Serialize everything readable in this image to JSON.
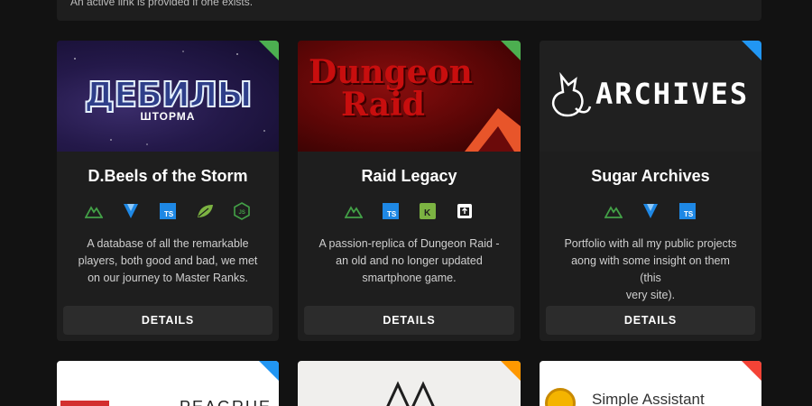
{
  "banner": {
    "text": "An active link is provided if one exists."
  },
  "cards": [
    {
      "title": "D.Beels of the Storm",
      "logo_main": "ДЕБИЛЫ",
      "logo_sub": "ШТОРМА",
      "ribbon_color": "#4caf50",
      "description_lines": [
        "A database of all the remarkable",
        "players, both good and bad, we met",
        "on our journey to Master Ranks."
      ],
      "button": "DETAILS",
      "icons": [
        "nuxt-icon",
        "vuetify-icon",
        "typescript-icon",
        "leaf-icon",
        "nodejs-icon"
      ]
    },
    {
      "title": "Raid Legacy",
      "logo_line1": "Dungeon",
      "logo_line2": "Raid",
      "ribbon_color": "#4caf50",
      "description_lines": [
        "A passion-replica of Dungeon Raid -",
        "an old and no longer updated",
        "smartphone game."
      ],
      "button": "DETAILS",
      "icons": [
        "nuxt-icon",
        "typescript-icon",
        "ktor-icon",
        "open-external-icon"
      ]
    },
    {
      "title": "Sugar Archives",
      "logo_text": "ARCHIVES",
      "ribbon_color": "#2196f3",
      "description_lines": [
        "Portfolio with all my public projects",
        "aong with some insight on them (this",
        "very site)."
      ],
      "button": "DETAILS",
      "icons": [
        "nuxt-icon",
        "vuetify-icon",
        "typescript-icon"
      ]
    }
  ],
  "bottom_cards": [
    {
      "ribbon_color": "#2196f3",
      "partial_text": "PEAGRUE"
    },
    {
      "ribbon_color": "#ff9800"
    },
    {
      "ribbon_color": "#f44336",
      "partial_text": "Simple Assistant"
    }
  ]
}
